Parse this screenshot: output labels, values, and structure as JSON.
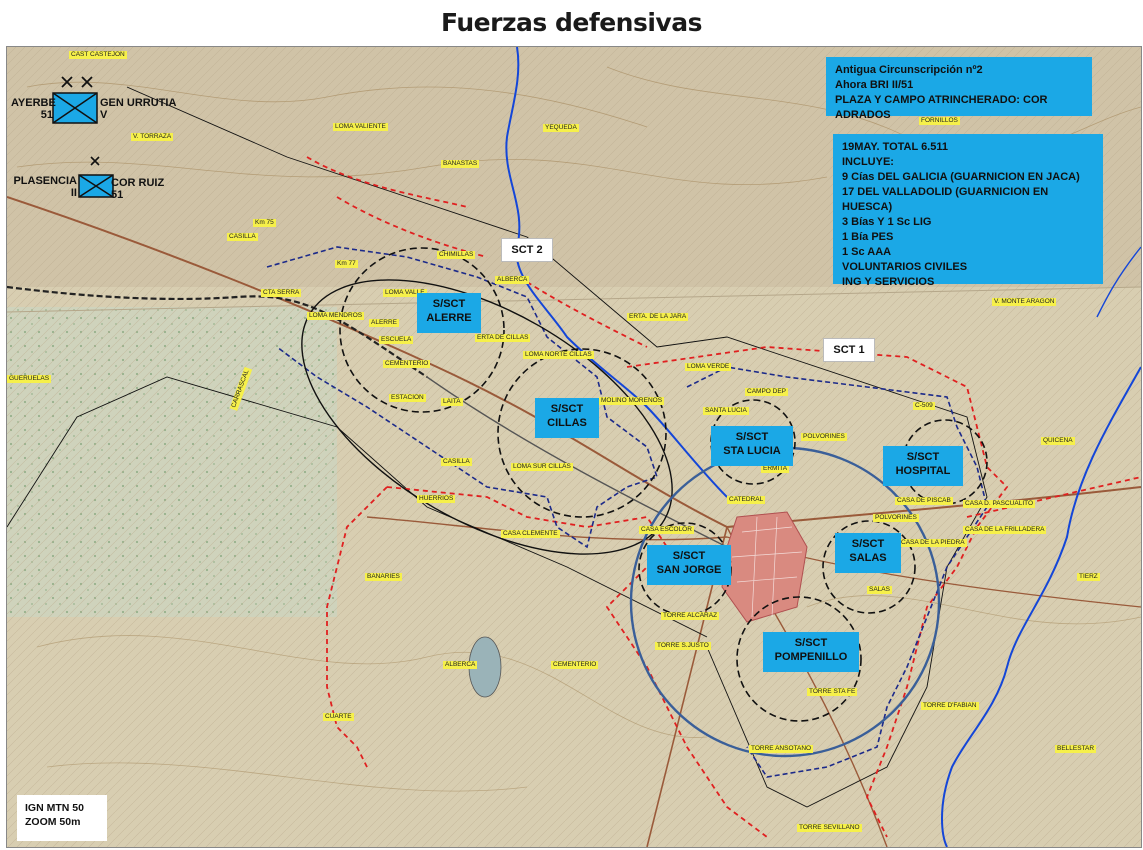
{
  "title": "Fuerzas defensivas",
  "colors": {
    "sub_box": "#1ba8e6",
    "river": "#1446d8",
    "red_line": "#e02020",
    "navy_line": "#1c2a8a",
    "sector_circle": "#3a5f99"
  },
  "info_box_1": {
    "line1": "Antigua Circunscripción nº2",
    "line2": "Ahora BRI II/51",
    "line3": "PLAZA Y CAMPO ATRINCHERADO: COR ADRADOS"
  },
  "info_box_2": {
    "lines": [
      "19MAY. TOTAL 6.511",
      "INCLUYE:",
      "9 Cías DEL GALICIA (GUARNICION EN JACA)",
      "17 DEL VALLADOLID (GUARNICION EN HUESCA)",
      "3 Bías Y 1 Sc LIG",
      "1 Bía PES",
      "1 Sc AAA",
      "VOLUNTARIOS CIVILES",
      "ING Y SERVICIOS"
    ]
  },
  "sectors": {
    "sct1": "SCT 1",
    "sct2": "SCT 2"
  },
  "subsectors": [
    {
      "line1": "S/SCT",
      "line2": "ALERRE"
    },
    {
      "line1": "S/SCT",
      "line2": "CILLAS"
    },
    {
      "line1": "S/SCT",
      "line2": "STA LUCIA"
    },
    {
      "line1": "S/SCT",
      "line2": "HOSPITAL"
    },
    {
      "line1": "S/SCT",
      "line2": "SAN JORGE"
    },
    {
      "line1": "S/SCT",
      "line2": "SALAS"
    },
    {
      "line1": "S/SCT",
      "line2": "POMPENILLO"
    }
  ],
  "units": {
    "unit1": {
      "left": "AYERBE",
      "left_num": "51",
      "right": "GEN URRUTIA",
      "right_num": "V"
    },
    "unit2": {
      "left": "PLASENCIA",
      "left_num": "II",
      "right": "COR RUIZ",
      "right_num": "51"
    }
  },
  "source": {
    "line1": "IGN MTN 50",
    "line2": "ZOOM 50m"
  },
  "places": [
    "CAST CASTEJON",
    "V. TORRAZA",
    "LOMA VALIENTE",
    "YEQUEDA",
    "BANASTAS",
    "FORNILLOS",
    "Km 75",
    "CASILLA",
    "Km 77",
    "CHIMILLAS",
    "ALBERCA",
    "CTA SERRA",
    "LOMA VALLE",
    "LOMA MENDROS",
    "ALERRE",
    "ESCUELA",
    "CEMENTERIO",
    "ERTA DE CILLAS",
    "LOMA NORTE CILLAS",
    "ERTA. DE LA JARA",
    "V. MONTE ARAGON",
    "GUERUELAS",
    "CARRASCAL",
    "ESTACION",
    "LAITA",
    "CASILLA",
    "LOMA SUR CILLAS",
    "MOLINO MORENOS",
    "LOMA VERDE",
    "CAMPO DEP",
    "SANTA LUCIA",
    "C-509",
    "QUICENA",
    "POLVORINES",
    "ERMITA",
    "HUERRIOS",
    "CASA CLEMENTE",
    "CATEDRAL",
    "CASA ESCOLOR",
    "CASA D. PASCUALITO",
    "CASA DE PISCAB",
    "POLVORINES",
    "CASA DE LA FRILLADERA",
    "CASA DE LA PIEDRA",
    "BANARIES",
    "TORRE ALCARAZ",
    "TORRE S.JUSTO",
    "SALAS",
    "TIERZ",
    "ALBERCA",
    "CEMENTERIO",
    "TORRE STA FE",
    "TORRE D'FABIAN",
    "CUARTE",
    "TORRE ANSOTANO",
    "BELLESTAR",
    "TORRE SEVILLANO"
  ]
}
